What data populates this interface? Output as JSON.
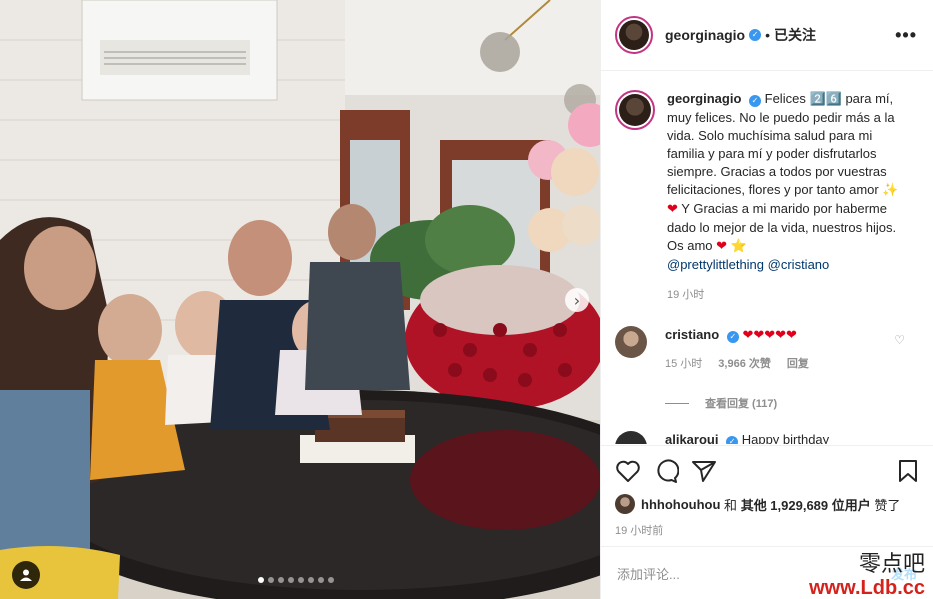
{
  "header": {
    "username": "georginagio",
    "verified_glyph": "✓",
    "separator": "•",
    "follow_status": "已关注",
    "more_glyph": "•••"
  },
  "caption": {
    "username": "georginagio",
    "text_1": "Felices",
    "number_badge": "2️⃣6️⃣",
    "text_2": "para mí, muy felices. No le puedo pedir más a la vida. Solo muchísima salud para mi familia y para mí y poder disfrutarlos siempre. Gracias a todos por vuestras felicitaciones, flores y por tanto amor",
    "emoji_1": "✨",
    "emoji_2": "❤",
    "text_3": "Y Gracias a mi marido por haberme dado lo mejor de la vida, nuestros hijos. Os amo",
    "emoji_3": "❤",
    "emoji_4": "⭐",
    "mention_1": "@prettylittlething",
    "mention_2": "@cristiano",
    "time": "19 小时"
  },
  "comments": [
    {
      "username": "cristiano",
      "text": "❤❤❤❤❤",
      "time": "15 小时",
      "likes": "3,966 次赞",
      "reply": "回复",
      "view_replies": "查看回复 (117)"
    },
    {
      "username": "alikaroui",
      "text": "Happy birthday"
    }
  ],
  "likes": {
    "user": "hhhohouhou",
    "and": "和",
    "others": "其他 1,929,689 位用户",
    "suffix": "赞了"
  },
  "posted_ago": "19 小时前",
  "add_comment": {
    "placeholder": "添加评论...",
    "post_label": "发布"
  },
  "watermark": {
    "line1": "零点吧",
    "line2": "www.Ldb.cc"
  },
  "carousel": {
    "slide_count": 8,
    "active_index": 0,
    "next_glyph": "›"
  },
  "colors": {
    "link": "#00376b",
    "verified": "#3897f0",
    "heart": "#e0001b",
    "watermark_red": "#d4221c"
  }
}
